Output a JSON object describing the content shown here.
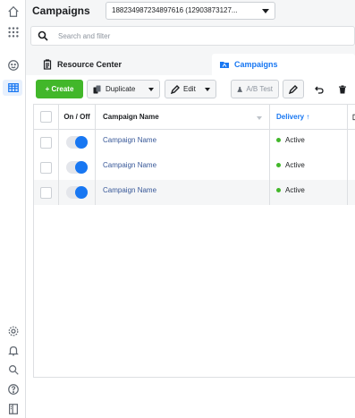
{
  "header": {
    "title": "Campaigns",
    "account_label": "188234987234897616 (12903873127..."
  },
  "search": {
    "placeholder": "Search and filter"
  },
  "tabs": [
    {
      "label": "Resource Center"
    },
    {
      "label": "Campaigns"
    }
  ],
  "toolbar": {
    "create_label": "+ Create",
    "duplicate_label": "Duplicate",
    "edit_label": "Edit",
    "ab_test_label": "A/B Test"
  },
  "table": {
    "columns": [
      "On / Off",
      "Campaign Name",
      "Delivery ↑"
    ],
    "rows": [
      {
        "name": "Campaign Name",
        "delivery": "Active"
      },
      {
        "name": "Campaign Name",
        "delivery": "Active"
      },
      {
        "name": "Campaign Name",
        "delivery": "Active"
      }
    ]
  },
  "colors": {
    "accent": "#1877f2",
    "create": "#42b72a",
    "active_dot": "#42b72a"
  },
  "icons": {
    "rail": [
      "home-icon",
      "apps-grid-icon",
      "smiley-icon",
      "table-icon",
      "settings-icon",
      "bell-icon",
      "search-icon",
      "help-icon",
      "panel-icon"
    ]
  }
}
